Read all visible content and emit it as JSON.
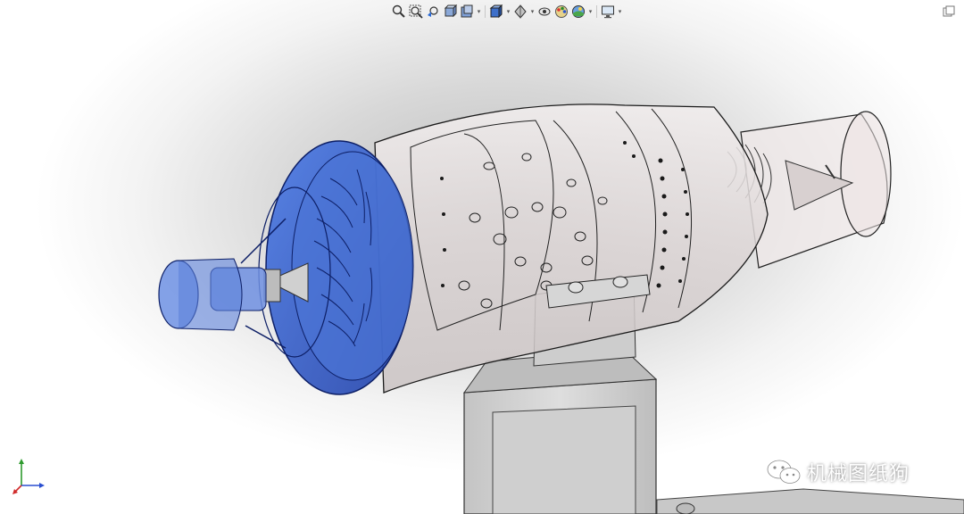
{
  "toolbar": {
    "tools": [
      {
        "icon": "zoom-to-fit-icon"
      },
      {
        "icon": "zoom-to-area-icon"
      },
      {
        "icon": "previous-view-icon"
      },
      {
        "icon": "section-view-icon"
      },
      {
        "icon": "dynamic-annotation-icon"
      },
      {
        "icon": "view-orientation-icon"
      },
      {
        "icon": "display-style-icon"
      },
      {
        "icon": "hide-show-items-icon"
      },
      {
        "icon": "edit-appearance-icon"
      },
      {
        "icon": "apply-scene-icon"
      },
      {
        "icon": "view-settings-icon"
      }
    ],
    "corner_icon": "window-restore-icon"
  },
  "viewport": {
    "triad_icon": "coordinate-triad-icon",
    "colors": {
      "highlight_blue": "#2f5fd0",
      "casing_gray": "#e2dcdc",
      "outline": "#1a1a1a",
      "stand_gray": "#d4d4d4"
    }
  },
  "watermark": {
    "icon": "wechat-icon",
    "text": "机械图纸狗"
  }
}
